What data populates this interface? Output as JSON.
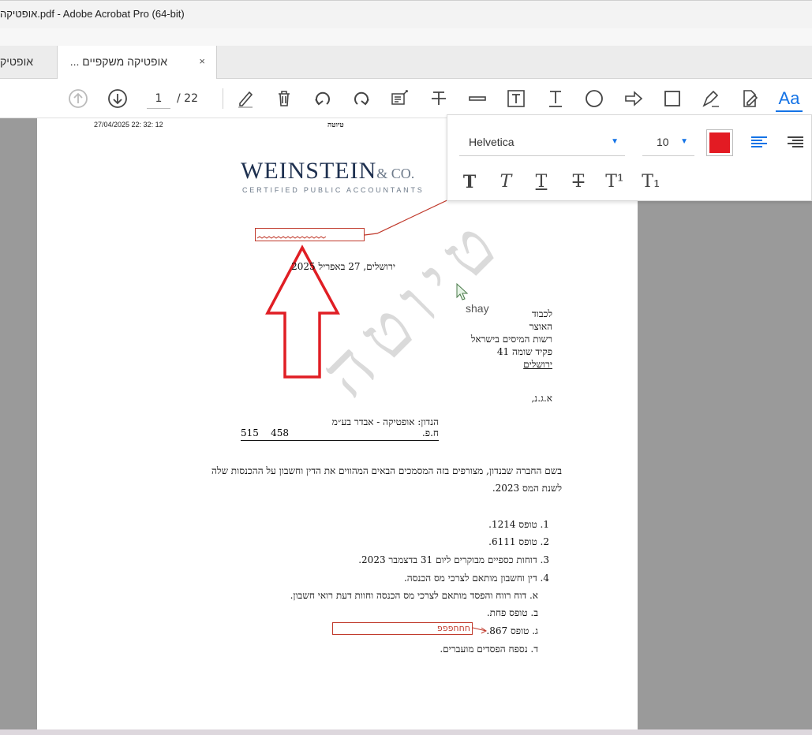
{
  "window": {
    "title": "אופטיקה.pdf - Adobe Acrobat Pro (64-bit)"
  },
  "tabs": [
    {
      "label": "אופטיק"
    },
    {
      "label": "אופטיקה משקפיים ...",
      "close": "×"
    }
  ],
  "toolbar": {
    "page_current": "1",
    "page_total": "/ 22",
    "text_tool": "Aa"
  },
  "text_panel": {
    "font": "Helvetica",
    "size": "10",
    "color": "#e31b23",
    "styles": [
      "T",
      "T",
      "T",
      "T",
      "T¹",
      "T₁"
    ]
  },
  "document": {
    "header_date": "27/04/2025 22: 32: 12",
    "header_title": "טיוטה",
    "logo_main": "WEINSTEIN",
    "logo_co": "& CO.",
    "logo_sub": "CERTIFIED PUBLIC ACCOUNTANTS",
    "date_line": "ירושלים, 27 באפריל 2025",
    "recipient": [
      "לכבוד",
      "האוצר",
      "רשות המיסים בישראל",
      "פקיד שומה 41",
      "ירושלים"
    ],
    "greeting": "א.ג.נ,",
    "subject_line": "הנדון: אופטיקה - אבדר בע״מ",
    "company_id_label": "ח.פ.",
    "company_id_value": "515    458",
    "body_line1": "בשם החברה שבנדון, מצורפים בזה המסמכים הבאים המהווים את הדין וחשבון על ההכנסות שלה",
    "body_line2": "לשנת המס 2023.",
    "list": [
      "1. טופס 1214.",
      "2. טופס 6111.",
      "3. דוחות כספיים מבוקרים ליום 31 בדצמבר 2023.",
      "4. דין וחשבון מותאם לצרכי מס הכנסה.",
      "א. דוח רווח והפסד מותאם לצרכי מס הכנסה וחוות דעת רואי חשבון.",
      "ב. טופס פחת.",
      "ג. טופס 867.",
      "ד. נספח הפסדים מועברים."
    ],
    "watermark": "טיוטה",
    "annotation_text": "חחחפפפ",
    "annotation_author": "shay"
  },
  "colors": {
    "accent": "#1473e6",
    "annotation": "#c0392b",
    "arrow": "#e01e24"
  }
}
